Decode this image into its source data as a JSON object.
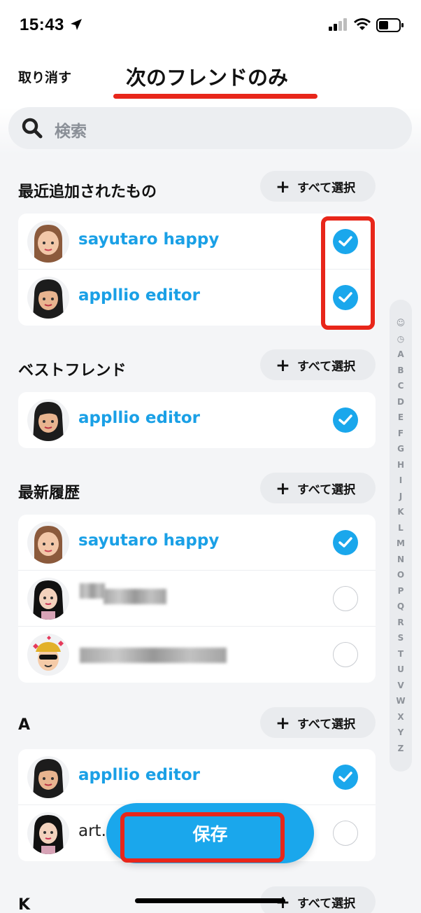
{
  "status_bar": {
    "time": "15:43"
  },
  "header": {
    "cancel_label": "取り消す",
    "title": "次のフレンドのみ"
  },
  "search": {
    "placeholder": "検索"
  },
  "select_all_label": "すべて選択",
  "sections": [
    {
      "title": "最近追加されたもの",
      "friends": [
        {
          "name": "sayutaro happy",
          "selected": true
        },
        {
          "name": "appllio editor",
          "selected": true
        }
      ]
    },
    {
      "title": "ベストフレンド",
      "friends": [
        {
          "name": "appllio editor",
          "selected": true
        }
      ]
    },
    {
      "title": "最新履歴",
      "friends": [
        {
          "name": "sayutaro happy",
          "selected": true
        },
        {
          "name": "",
          "selected": false
        },
        {
          "name": "",
          "selected": false
        }
      ]
    },
    {
      "title": "A",
      "friends": [
        {
          "name": "appllio editor",
          "selected": true
        },
        {
          "name": "art.a",
          "selected": false
        }
      ]
    },
    {
      "title": "K",
      "friends": []
    }
  ],
  "alphabet_index": [
    "☺",
    "◷",
    "A",
    "B",
    "C",
    "D",
    "E",
    "F",
    "G",
    "H",
    "I",
    "J",
    "K",
    "L",
    "M",
    "N",
    "O",
    "P",
    "Q",
    "R",
    "S",
    "T",
    "U",
    "V",
    "W",
    "X",
    "Y",
    "Z"
  ],
  "save_label": "保存",
  "colors": {
    "accent": "#1aa7ec",
    "annotation_red": "#e8261a",
    "name_blue": "#1aa0e6"
  }
}
